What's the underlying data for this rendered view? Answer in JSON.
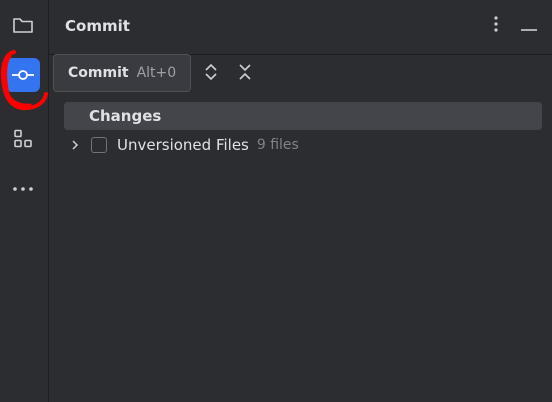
{
  "panel": {
    "title": "Commit"
  },
  "toolbar": {
    "tooltip_label": "Commit",
    "tooltip_shortcut": "Alt+0"
  },
  "tree": {
    "group_label": "Changes",
    "items": [
      {
        "label": "Unversioned Files",
        "count": "9 files",
        "checked": false
      }
    ]
  },
  "toolstrip": {
    "items": [
      {
        "icon": "folder-icon",
        "active": false
      },
      {
        "icon": "commit-icon",
        "active": true
      },
      {
        "icon": "structure-icon",
        "active": false
      },
      {
        "icon": "more-icon",
        "active": false
      }
    ],
    "accent_color": "#3574f0",
    "annotation_color": "#ff0000"
  }
}
